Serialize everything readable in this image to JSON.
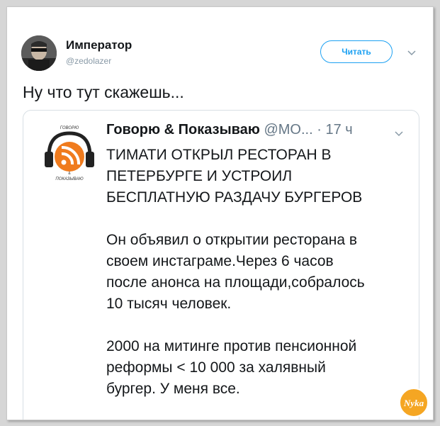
{
  "author": {
    "name": "Император",
    "handle": "@zedolazer"
  },
  "follow_button": {
    "label": "Читать"
  },
  "tweet_text": "Ну что тут скажешь...",
  "quoted": {
    "name": "Говорю & Показываю",
    "handle": "@МО...",
    "separator": "·",
    "time": "17 ч",
    "logo": {
      "top_text": "ГОВОРЮ",
      "mid_text": "&",
      "bottom_text": "ПОКАЗЫВАЮ",
      "brand_color": "#f07b1d"
    },
    "headline_lines": [
      "ТИМАТИ ОТКРЫЛ РЕСТОРАН В",
      "ПЕТЕРБУРГЕ И УСТРОИЛ",
      "БЕСПЛАТНУЮ РАЗДАЧУ БУРГЕРОВ"
    ],
    "paragraph1_lines": [
      "Он объявил о открытии ресторана в",
      "своем инстаграме.Через 6 часов",
      "после анонса на площади,собралось",
      "10 тысяч человек."
    ],
    "paragraph2_lines": [
      "2000 на митинге против пенсионной",
      "реформы < 10 000 за халявный",
      "бургер. У меня все."
    ]
  },
  "watermark": {
    "text": "Nyka",
    "color": "#f5a623"
  },
  "colors": {
    "accent": "#1da1f2",
    "secondary_text": "#657786"
  }
}
